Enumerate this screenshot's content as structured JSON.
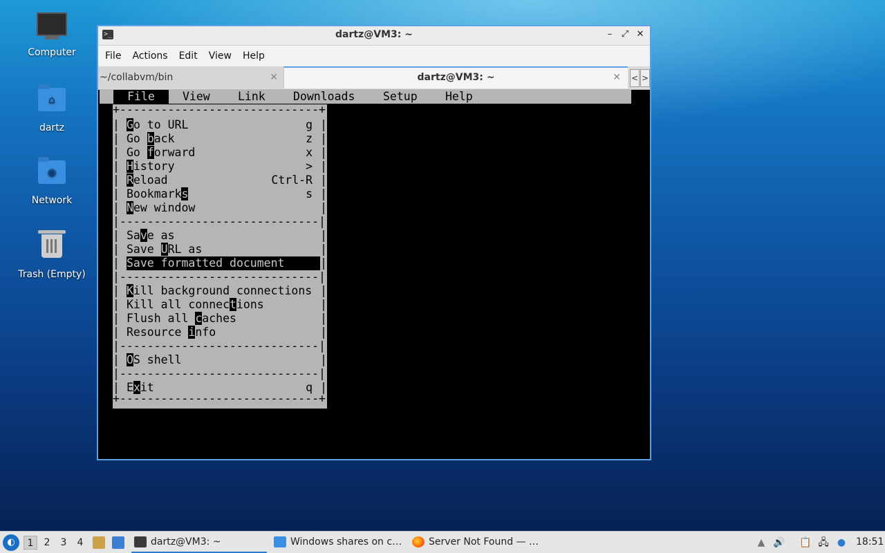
{
  "desktop": {
    "icons": [
      {
        "label": "Computer"
      },
      {
        "label": "dartz"
      },
      {
        "label": "Network"
      },
      {
        "label": "Trash (Empty)"
      }
    ]
  },
  "window": {
    "title": "dartz@VM3: ~",
    "menu": [
      "File",
      "Actions",
      "Edit",
      "View",
      "Help"
    ],
    "tabs": [
      {
        "label": "~/collabvm/bin",
        "active": false
      },
      {
        "label": "dartz@VM3: ~",
        "active": true
      }
    ],
    "tab_close": "✕",
    "tab_prev": "<",
    "tab_next": ">",
    "buttons": {
      "minimize": "–",
      "maximize": "⤢",
      "close": "✕"
    }
  },
  "lynx": {
    "menubar": [
      "File",
      "View",
      "Link",
      "Downloads",
      "Setup",
      "Help"
    ],
    "active_menu": "File",
    "border_top": "+-----------------------------+",
    "separator": "|-----------------------------|",
    "file_menu": [
      {
        "pre": "",
        "hk": "G",
        "post": "o to URL",
        "shortcut": "g"
      },
      {
        "pre": "Go ",
        "hk": "b",
        "post": "ack",
        "shortcut": "z"
      },
      {
        "pre": "Go ",
        "hk": "f",
        "post": "orward",
        "shortcut": "x"
      },
      {
        "pre": "",
        "hk": "H",
        "post": "istory",
        "shortcut": ">"
      },
      {
        "pre": "",
        "hk": "R",
        "post": "eload",
        "shortcut": "Ctrl-R"
      },
      {
        "pre": "Bookmark",
        "hk": "s",
        "post": "",
        "shortcut": "s"
      },
      {
        "pre": "",
        "hk": "N",
        "post": "ew window",
        "shortcut": ""
      },
      {
        "separator": true
      },
      {
        "pre": "Sa",
        "hk": "v",
        "post": "e as",
        "shortcut": ""
      },
      {
        "pre": "Save ",
        "hk": "U",
        "post": "RL as",
        "shortcut": ""
      },
      {
        "pre": "Save formatted document",
        "hk": "",
        "post": "",
        "shortcut": "",
        "selected": true
      },
      {
        "separator": true
      },
      {
        "pre": "",
        "hk": "K",
        "post": "ill background connections",
        "shortcut": ""
      },
      {
        "pre": "Kill all connec",
        "hk": "t",
        "post": "ions",
        "shortcut": ""
      },
      {
        "pre": "Flush all ",
        "hk": "c",
        "post": "aches",
        "shortcut": ""
      },
      {
        "pre": "Resource ",
        "hk": "i",
        "post": "nfo",
        "shortcut": ""
      },
      {
        "separator": true
      },
      {
        "pre": "",
        "hk": "O",
        "post": "S shell",
        "shortcut": ""
      },
      {
        "separator": true
      },
      {
        "pre": "E",
        "hk": "x",
        "post": "it",
        "shortcut": "q"
      }
    ]
  },
  "taskbar": {
    "workspaces": [
      "1",
      "2",
      "3",
      "4"
    ],
    "tasks": [
      {
        "label": "dartz@VM3: ~",
        "active": true
      },
      {
        "label": "Windows shares on c…",
        "active": false
      },
      {
        "label": "Server Not Found — …",
        "active": false
      }
    ],
    "clock": "18:51"
  }
}
